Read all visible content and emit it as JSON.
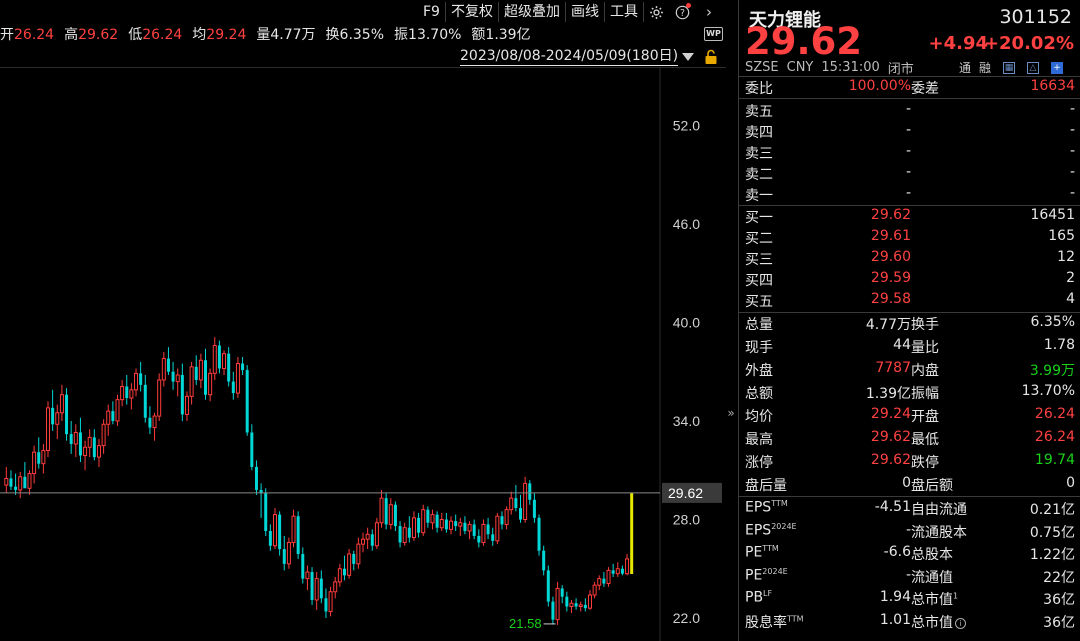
{
  "toolbar": {
    "items": [
      "F9",
      "不复权",
      "超级叠加",
      "画线",
      "工具"
    ],
    "icons": [
      "gear-icon",
      "help-icon",
      "chevron-right-icon"
    ]
  },
  "quote_strip": {
    "open_label": "开",
    "open": "26.24",
    "high_label": "高",
    "high": "29.62",
    "low_label": "低",
    "low": "26.24",
    "avg_label": "均",
    "avg": "29.24",
    "vol_label": "量",
    "vol": "4.77万",
    "turnover_label": "换",
    "turnover": "6.35%",
    "amp_label": "振",
    "amp": "13.70%",
    "amount_label": "额",
    "amount": "1.39亿"
  },
  "wp_badge": "WP",
  "range": {
    "text": "2023/08/08-2024/05/09(180日)"
  },
  "chart_data": {
    "type": "candlestick",
    "y_ticks": [
      "52.0",
      "46.0",
      "40.0",
      "34.0",
      "28.0",
      "22.0"
    ],
    "ylim": [
      20.6,
      55.5
    ],
    "last_price_label": "29.62",
    "min_annotation": "21.58",
    "candles": [
      [
        30.1,
        31.2,
        29.6,
        30.5
      ],
      [
        30.5,
        31.0,
        29.8,
        30.0
      ],
      [
        30.0,
        30.8,
        29.5,
        29.8
      ],
      [
        29.8,
        30.9,
        29.3,
        30.6
      ],
      [
        30.6,
        31.5,
        30.0,
        29.9
      ],
      [
        29.9,
        31.0,
        29.5,
        30.8
      ],
      [
        30.8,
        32.5,
        30.2,
        32.1
      ],
      [
        32.1,
        33.0,
        31.1,
        31.4
      ],
      [
        31.4,
        32.6,
        30.8,
        32.2
      ],
      [
        32.2,
        35.2,
        31.8,
        34.8
      ],
      [
        34.8,
        35.9,
        33.4,
        33.8
      ],
      [
        33.8,
        35.0,
        32.9,
        34.5
      ],
      [
        34.5,
        36.2,
        34.0,
        35.6
      ],
      [
        35.6,
        36.0,
        32.8,
        33.2
      ],
      [
        33.2,
        34.0,
        32.0,
        32.6
      ],
      [
        32.6,
        33.8,
        31.8,
        33.3
      ],
      [
        33.3,
        34.2,
        31.5,
        31.9
      ],
      [
        31.9,
        32.8,
        31.0,
        32.4
      ],
      [
        32.4,
        33.5,
        31.8,
        33.0
      ],
      [
        33.0,
        33.5,
        31.6,
        31.8
      ],
      [
        31.8,
        32.9,
        31.2,
        32.5
      ],
      [
        32.5,
        34.1,
        32.0,
        33.8
      ],
      [
        33.8,
        35.0,
        33.1,
        34.6
      ],
      [
        34.6,
        35.2,
        33.8,
        34.0
      ],
      [
        34.0,
        35.6,
        33.7,
        35.3
      ],
      [
        35.3,
        36.5,
        34.9,
        36.1
      ],
      [
        36.1,
        36.8,
        35.0,
        35.4
      ],
      [
        35.4,
        36.3,
        34.7,
        35.9
      ],
      [
        35.9,
        37.2,
        35.5,
        36.9
      ],
      [
        36.9,
        37.6,
        35.8,
        36.2
      ],
      [
        36.2,
        36.8,
        33.9,
        34.2
      ],
      [
        34.2,
        34.9,
        33.2,
        33.6
      ],
      [
        33.6,
        34.5,
        32.8,
        34.3
      ],
      [
        34.3,
        36.9,
        34.0,
        36.5
      ],
      [
        36.5,
        38.2,
        36.1,
        37.8
      ],
      [
        37.8,
        38.5,
        36.8,
        37.0
      ],
      [
        37.0,
        37.6,
        35.9,
        36.4
      ],
      [
        36.4,
        37.2,
        35.5,
        36.8
      ],
      [
        36.8,
        37.5,
        34.0,
        34.4
      ],
      [
        34.4,
        35.8,
        34.0,
        35.5
      ],
      [
        35.5,
        37.6,
        35.0,
        37.3
      ],
      [
        37.3,
        38.0,
        36.2,
        36.5
      ],
      [
        36.5,
        38.1,
        36.0,
        37.7
      ],
      [
        37.7,
        38.4,
        35.3,
        35.6
      ],
      [
        35.6,
        37.2,
        35.2,
        36.9
      ],
      [
        36.9,
        39.1,
        36.5,
        38.6
      ],
      [
        38.6,
        38.9,
        36.9,
        37.2
      ],
      [
        37.2,
        38.3,
        36.8,
        38.1
      ],
      [
        38.1,
        38.5,
        36.1,
        36.4
      ],
      [
        36.4,
        37.0,
        35.3,
        35.7
      ],
      [
        35.7,
        37.9,
        35.4,
        37.5
      ],
      [
        37.5,
        37.9,
        36.8,
        37.1
      ],
      [
        37.1,
        37.4,
        33.1,
        33.3
      ],
      [
        33.3,
        33.8,
        31.0,
        31.2
      ],
      [
        31.2,
        31.6,
        29.5,
        29.8
      ],
      [
        29.8,
        30.2,
        28.1,
        29.6
      ],
      [
        29.6,
        29.9,
        27.0,
        27.3
      ],
      [
        27.3,
        27.7,
        26.1,
        26.4
      ],
      [
        26.4,
        28.7,
        26.2,
        28.3
      ],
      [
        28.3,
        28.5,
        25.8,
        26.2
      ],
      [
        26.2,
        27.0,
        24.9,
        25.3
      ],
      [
        25.3,
        26.9,
        25.0,
        26.6
      ],
      [
        26.6,
        28.6,
        26.3,
        28.2
      ],
      [
        28.2,
        28.5,
        25.6,
        25.9
      ],
      [
        25.9,
        26.3,
        24.1,
        24.4
      ],
      [
        24.4,
        25.2,
        23.7,
        24.8
      ],
      [
        24.8,
        25.1,
        22.8,
        23.1
      ],
      [
        23.1,
        24.8,
        22.5,
        24.4
      ],
      [
        24.4,
        24.9,
        22.9,
        23.2
      ],
      [
        23.2,
        23.8,
        22.0,
        22.4
      ],
      [
        22.4,
        23.9,
        22.1,
        23.6
      ],
      [
        23.6,
        24.5,
        23.2,
        24.2
      ],
      [
        24.2,
        25.3,
        23.9,
        25.0
      ],
      [
        25.0,
        25.8,
        24.3,
        24.6
      ],
      [
        24.6,
        26.2,
        24.4,
        25.9
      ],
      [
        25.9,
        26.1,
        24.9,
        25.3
      ],
      [
        25.3,
        26.9,
        25.0,
        26.5
      ],
      [
        26.5,
        27.2,
        26.0,
        26.8
      ],
      [
        26.8,
        27.5,
        26.2,
        27.1
      ],
      [
        27.1,
        27.4,
        26.1,
        26.4
      ],
      [
        26.4,
        28.1,
        26.2,
        27.8
      ],
      [
        27.8,
        29.8,
        27.5,
        29.3
      ],
      [
        29.3,
        29.6,
        27.4,
        27.7
      ],
      [
        27.7,
        29.3,
        27.4,
        28.9
      ],
      [
        28.9,
        29.1,
        27.3,
        27.6
      ],
      [
        27.6,
        27.9,
        26.3,
        26.6
      ],
      [
        26.6,
        27.8,
        26.4,
        27.5
      ],
      [
        27.5,
        28.2,
        26.6,
        26.9
      ],
      [
        26.9,
        28.5,
        26.7,
        28.1
      ],
      [
        28.1,
        28.4,
        26.9,
        27.2
      ],
      [
        27.2,
        28.9,
        27.0,
        28.6
      ],
      [
        28.6,
        28.8,
        27.5,
        27.8
      ],
      [
        27.8,
        28.6,
        27.4,
        28.3
      ],
      [
        28.3,
        28.5,
        27.2,
        27.5
      ],
      [
        27.5,
        28.4,
        27.3,
        28.0
      ],
      [
        28.0,
        28.4,
        27.2,
        27.4
      ],
      [
        27.4,
        28.2,
        27.1,
        27.9
      ],
      [
        27.9,
        28.3,
        27.3,
        27.6
      ],
      [
        27.6,
        28.1,
        27.0,
        27.8
      ],
      [
        27.8,
        28.2,
        27.1,
        27.3
      ],
      [
        27.3,
        27.9,
        26.8,
        27.7
      ],
      [
        27.7,
        28.0,
        26.8,
        27.0
      ],
      [
        27.0,
        27.4,
        26.3,
        26.6
      ],
      [
        26.6,
        28.0,
        26.4,
        27.7
      ],
      [
        27.7,
        28.1,
        26.8,
        27.1
      ],
      [
        27.1,
        27.5,
        26.4,
        26.7
      ],
      [
        26.7,
        28.4,
        26.5,
        28.2
      ],
      [
        28.2,
        28.5,
        27.4,
        27.7
      ],
      [
        27.7,
        28.8,
        27.4,
        28.6
      ],
      [
        28.6,
        29.7,
        28.3,
        29.3
      ],
      [
        29.3,
        30.1,
        28.5,
        28.7
      ],
      [
        28.7,
        29.5,
        27.8,
        28.0
      ],
      [
        28.0,
        30.6,
        27.8,
        30.2
      ],
      [
        30.2,
        30.4,
        28.9,
        29.2
      ],
      [
        29.2,
        29.6,
        27.8,
        28.1
      ],
      [
        28.1,
        28.3,
        25.8,
        26.1
      ],
      [
        26.1,
        26.4,
        24.6,
        24.9
      ],
      [
        24.9,
        25.2,
        22.7,
        23.0
      ],
      [
        23.0,
        23.3,
        21.6,
        21.9
      ],
      [
        21.9,
        24.2,
        21.58,
        23.8
      ],
      [
        23.8,
        24.0,
        22.9,
        23.3
      ],
      [
        23.3,
        23.6,
        22.4,
        22.7
      ],
      [
        22.7,
        23.1,
        22.3,
        22.9
      ],
      [
        22.9,
        23.2,
        22.5,
        22.7
      ],
      [
        22.7,
        23.0,
        22.4,
        22.8
      ],
      [
        22.8,
        23.2,
        22.4,
        22.6
      ],
      [
        22.6,
        23.7,
        22.5,
        23.4
      ],
      [
        23.4,
        24.2,
        23.2,
        24.0
      ],
      [
        24.0,
        24.6,
        23.7,
        24.4
      ],
      [
        24.4,
        24.8,
        23.9,
        24.1
      ],
      [
        24.1,
        25.1,
        23.9,
        24.9
      ],
      [
        24.9,
        25.3,
        24.5,
        24.7
      ],
      [
        24.7,
        25.4,
        24.5,
        25.0
      ],
      [
        25.0,
        25.2,
        24.6,
        24.7
      ],
      [
        24.7,
        25.9,
        24.6,
        25.6
      ],
      [
        24.68,
        29.62,
        24.68,
        29.62
      ]
    ]
  },
  "panel": {
    "name": "天力锂能",
    "code": "301152",
    "price": "29.62",
    "change": "+4.94",
    "change_pct": "+20.02%",
    "meta": [
      "SZSE",
      "CNY",
      "15:31:00",
      "闭市"
    ],
    "tags": [
      "通",
      "融"
    ],
    "wei_bi_label": "委比",
    "wei_bi": "100.00%",
    "wei_cha_label": "委差",
    "wei_cha": "16634",
    "asks": [
      {
        "label": "卖五",
        "price": "-",
        "vol": "-"
      },
      {
        "label": "卖四",
        "price": "-",
        "vol": "-"
      },
      {
        "label": "卖三",
        "price": "-",
        "vol": "-"
      },
      {
        "label": "卖二",
        "price": "-",
        "vol": "-"
      },
      {
        "label": "卖一",
        "price": "-",
        "vol": "-"
      }
    ],
    "bids": [
      {
        "label": "买一",
        "price": "29.62",
        "vol": "16451"
      },
      {
        "label": "买二",
        "price": "29.61",
        "vol": "165"
      },
      {
        "label": "买三",
        "price": "29.60",
        "vol": "12"
      },
      {
        "label": "买四",
        "price": "29.59",
        "vol": "2"
      },
      {
        "label": "买五",
        "price": "29.58",
        "vol": "4"
      }
    ],
    "stats": [
      {
        "l1": "总量",
        "v1": "4.77万",
        "c1": "white",
        "l2": "换手",
        "v2": "6.35%",
        "c2": "white"
      },
      {
        "l1": "现手",
        "v1": "44",
        "c1": "white",
        "l2": "量比",
        "v2": "1.78",
        "c2": "white"
      },
      {
        "l1": "外盘",
        "v1": "7787",
        "c1": "red",
        "l2": "内盘",
        "v2": "3.99万",
        "c2": "green"
      },
      {
        "l1": "总额",
        "v1": "1.39亿",
        "c1": "white",
        "l2": "振幅",
        "v2": "13.70%",
        "c2": "white"
      },
      {
        "l1": "均价",
        "v1": "29.24",
        "c1": "red",
        "l2": "开盘",
        "v2": "26.24",
        "c2": "red"
      },
      {
        "l1": "最高",
        "v1": "29.62",
        "c1": "red",
        "l2": "最低",
        "v2": "26.24",
        "c2": "red"
      },
      {
        "l1": "涨停",
        "v1": "29.62",
        "c1": "red",
        "l2": "跌停",
        "v2": "19.74",
        "c2": "green"
      },
      {
        "l1": "盘后量",
        "v1": "0",
        "c1": "white",
        "l2": "盘后额",
        "v2": "0",
        "c2": "white"
      }
    ],
    "fundamentals": [
      {
        "l1": "EPS",
        "s1": "TTM",
        "v1": "-4.51",
        "l2": "自由流通",
        "s2": "",
        "v2": "0.21亿"
      },
      {
        "l1": "EPS",
        "s1": "2024E",
        "v1": "-",
        "l2": "流通股本",
        "s2": "",
        "v2": "0.75亿"
      },
      {
        "l1": "PE",
        "s1": "TTM",
        "v1": "-6.6",
        "l2": "总股本",
        "s2": "",
        "v2": "1.22亿"
      },
      {
        "l1": "PE",
        "s1": "2024E",
        "v1": "-",
        "l2": "流通值",
        "s2": "",
        "v2": "22亿"
      },
      {
        "l1": "PB",
        "s1": "LF",
        "v1": "1.94",
        "l2": "总市值",
        "s2": "1",
        "v2": "36亿"
      },
      {
        "l1": "股息率",
        "s1": "TTM",
        "v1": "1.01",
        "l2": "总市值",
        "s2": "",
        "v2": "36亿"
      }
    ],
    "colors": {
      "up": "#ff4141",
      "down": "#19d219",
      "up_candle_body": "#000000",
      "down_candle": "#00e0e0",
      "highlight": "#e6e600"
    }
  }
}
